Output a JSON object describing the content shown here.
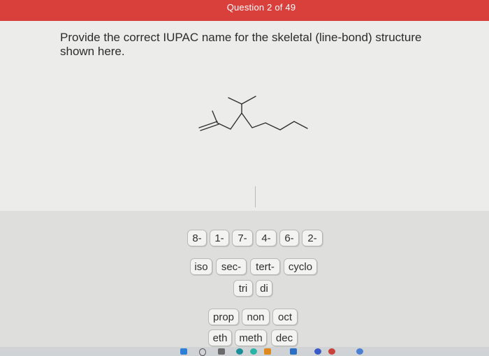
{
  "header": {
    "title": "Question 2 of 49"
  },
  "question": {
    "prompt": "Provide the correct IUPAC name for the skeletal (line-bond) structure shown here."
  },
  "answer_tiles": {
    "locants": [
      "8-",
      "1-",
      "7-",
      "4-",
      "6-",
      "2-"
    ],
    "prefixes": [
      "iso",
      "sec-",
      "tert-",
      "cyclo"
    ],
    "multipliers": [
      "tri",
      "di"
    ],
    "roots_row1": [
      "prop",
      "non",
      "oct"
    ],
    "roots_row2": [
      "eth",
      "meth",
      "dec"
    ]
  },
  "colors": {
    "header": "#d9403c",
    "tile_bg": "#f3f3f1",
    "tile_border": "#b9b9b6"
  },
  "icons": [
    "windows-start-icon",
    "search-icon",
    "task-view-icon",
    "edge-icon",
    "store-icon",
    "mail-icon",
    "notification-badge-icon"
  ]
}
